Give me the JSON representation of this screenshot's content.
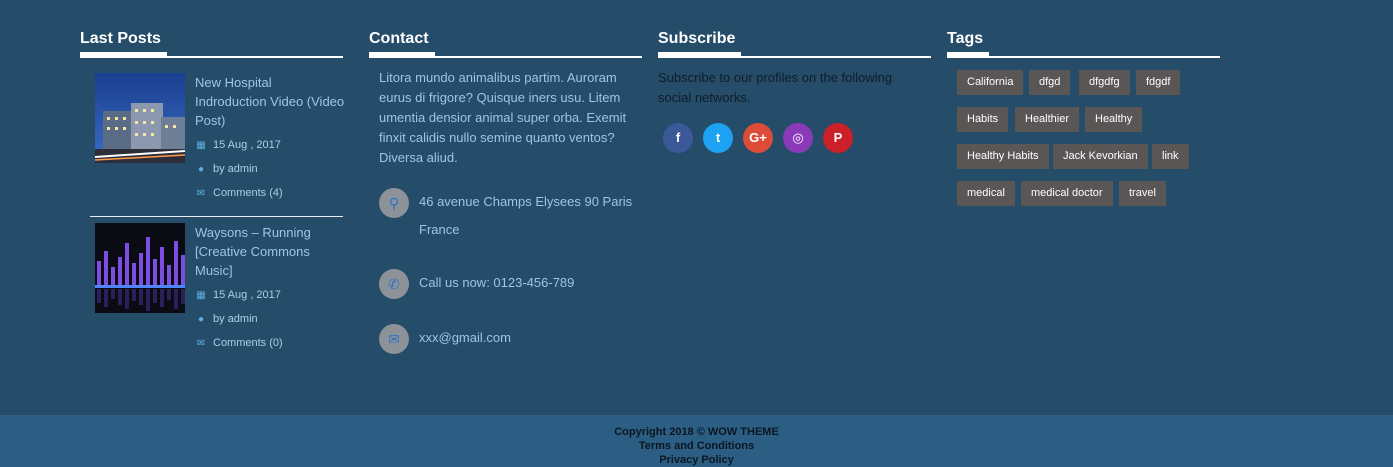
{
  "last_posts": {
    "title": "Last Posts",
    "posts": [
      {
        "title": "New Hospital Indroduction Video (Video Post)",
        "date": "15 Aug , 2017",
        "author": "by admin",
        "comments": "Comments (4)",
        "date_icon": "calendar-icon",
        "author_icon": "user-icon",
        "comments_icon": "comments-icon"
      },
      {
        "title": "Waysons – Running [Creative Commons Music]",
        "date": "15 Aug , 2017",
        "author": "by admin",
        "comments": "Comments (0)",
        "date_icon": "calendar-icon",
        "author_icon": "user-icon",
        "comments_icon": "comments-icon"
      }
    ]
  },
  "contact": {
    "title": "Contact",
    "text": "Litora mundo animalibus partim. Auroram eurus di frigore? Quisque iners usu. Litem umentia densior animal super orba. Exemit finxit calidis nullo semine quanto ventos? Diversa aliud.",
    "address_line1": "46 avenue Champs Elysees 90 Paris",
    "address_line2": "France",
    "phone": "Call us now: 0123-456-789",
    "email": "xxx@gmail.com"
  },
  "subscribe": {
    "title": "Subscribe",
    "text": "Subscribe to our profiles on the following social networks.",
    "networks": [
      {
        "name": "facebook",
        "glyph": "f",
        "color": "#3b5998"
      },
      {
        "name": "twitter",
        "glyph": "t",
        "color": "#1da1f2"
      },
      {
        "name": "google-plus",
        "glyph": "G+",
        "color": "#dd4b39"
      },
      {
        "name": "instagram",
        "glyph": "◎",
        "color": "#8a3ab9"
      },
      {
        "name": "pinterest",
        "glyph": "P",
        "color": "#cb2027"
      }
    ]
  },
  "tags": {
    "title": "Tags",
    "items": [
      "California",
      "dfgd",
      "dfgdfg",
      "fdgdf",
      "Habits",
      "Healthier",
      "Healthy",
      "Healthy Habits",
      "Jack Kevorkian",
      "link",
      "medical",
      "medical doctor",
      "travel"
    ]
  },
  "footer": {
    "copyright": "Copyright 2018 © WOW THEME",
    "terms": "Terms and Conditions",
    "privacy": "Privacy Policy"
  }
}
